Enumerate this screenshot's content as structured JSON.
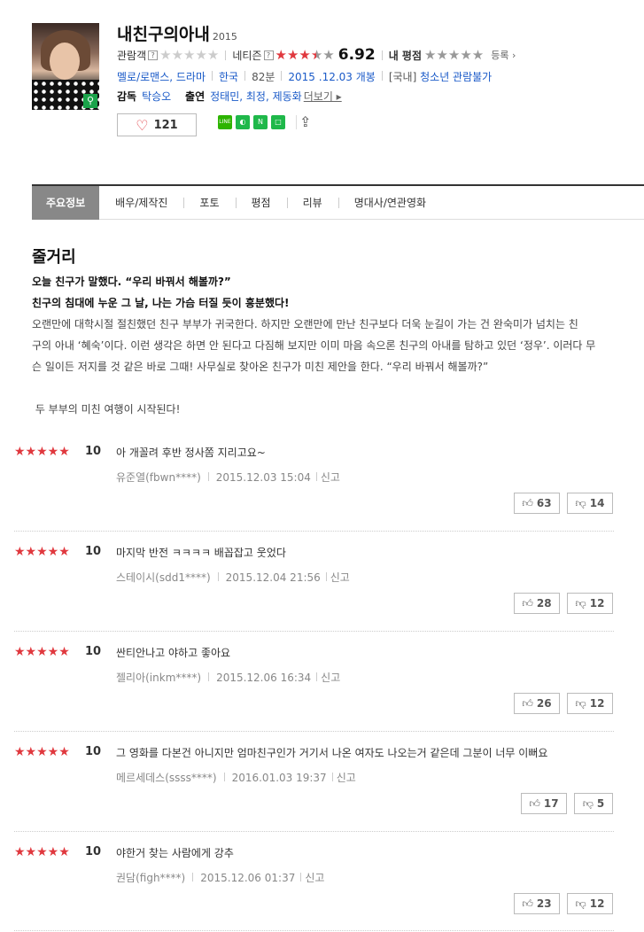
{
  "movie": {
    "title": "내친구의아내",
    "year": "2015",
    "audience_label": "관람객",
    "netizen_label": "네티즌",
    "netizen_score": "6.92",
    "my_rating_label": "내 평점",
    "register_label": "등록 ›",
    "genre": "멜로/로맨스, 드라마",
    "country": "한국",
    "runtime": "82분",
    "release": "2015 .12.03 개봉",
    "rating_region": "[국내]",
    "rating": "청소년 관람불가",
    "director_label": "감독",
    "director": "탁승오",
    "cast_label": "출연",
    "cast": "정태민, 최정, 제동화",
    "more_label": "더보기 ▸",
    "likes": "121"
  },
  "tabs": [
    "주요정보",
    "배우/제작진",
    "포토",
    "평점",
    "리뷰",
    "명대사/연관영화"
  ],
  "plot": {
    "heading": "줄거리",
    "line1": "오늘 친구가 말했다. “우리 바꿔서 해볼까?”",
    "line2": "친구의 침대에 누운 그 날, 나는 가슴 터질 듯이 흥분했다!",
    "body_1": "오랜만에 대학시절 절친했던 친구 부부가 귀국한다. 하지만 오랜만에 만난 친구보다 더욱 눈길이 가는 건 완숙미가 넘치는 친",
    "body_2": "구의 아내 ‘혜숙’이다. 이런 생각은 하면 안 된다고 다짐해 보지만 이미 마음 속으론 친구의 아내를 탐하고 있던 ‘정우’. 이러다 무",
    "body_3": "슨 일이든 저지를 것 같은 바로 그때! 사무실로 찾아온 친구가 미친 제안을 한다. “우리 바꿔서 해볼까?”",
    "closing": " 두 부부의 미친 여행이 시작된다!"
  },
  "reviews": [
    {
      "stars": "★★★★★",
      "score": "10",
      "text": "아 개꼴려 후반 정사쫌 지리고요~",
      "user": "유준열(fbwn****)",
      "date": "2015.12.03 15:04",
      "report": "신고",
      "up": "63",
      "down": "14"
    },
    {
      "stars": "★★★★★",
      "score": "10",
      "text": "마지막 반전 ㅋㅋㅋㅋ 배꼽잡고 웃었다",
      "user": "스테이시(sdd1****)",
      "date": "2015.12.04 21:56",
      "report": "신고",
      "up": "28",
      "down": "12"
    },
    {
      "stars": "★★★★★",
      "score": "10",
      "text": "싼티안나고 야하고 좋아요",
      "user": "젤리아(inkm****)",
      "date": "2015.12.06 16:34",
      "report": "신고",
      "up": "26",
      "down": "12"
    },
    {
      "stars": "★★★★★",
      "score": "10",
      "text": "그 영화를 다본건 아니지만 엄마친구인가 거기서 나온 여자도 나오는거 같은데 그분이 너무 이뻐요",
      "user": "메르세데스(ssss****)",
      "date": "2016.01.03 19:37",
      "report": "신고",
      "up": "17",
      "down": "5"
    },
    {
      "stars": "★★★★★",
      "score": "10",
      "text": "야한거 찾는 사람에게 강추",
      "user": "권담(figh****)",
      "date": "2015.12.06 01:37",
      "report": "신고",
      "up": "23",
      "down": "12"
    }
  ],
  "colors": {
    "accent_red": "#e0383e",
    "link_blue": "#1a5ac8",
    "tab_active": "#888888"
  }
}
